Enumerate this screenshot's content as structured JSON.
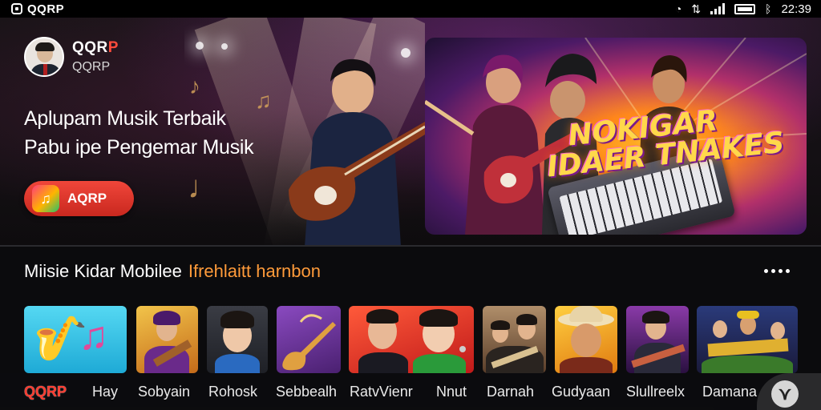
{
  "status_bar": {
    "app_name": "QQRP",
    "time": "22:39",
    "icons": [
      "app-icon",
      "wifi-icon",
      "data-icon",
      "signal-icon",
      "battery-icon",
      "bluetooth-icon"
    ]
  },
  "profile": {
    "name_prefix": "QQR",
    "name_accent": "P",
    "handle": "QQRP"
  },
  "hero": {
    "tagline_line1": "Aplupam Musik Terbaik",
    "tagline_line2": "Pabu ipe Pengemar Musik",
    "cta_label": "AQRP",
    "cta_icon": "app-logo-icon"
  },
  "promo": {
    "title_line1": "NOKIGAR",
    "title_line2": "IDAER TNAKES"
  },
  "section": {
    "title": "Miisie Kidar Mobilee",
    "accent": "Ifrehlaitt harnbon",
    "more_icon": "more-dots-icon"
  },
  "thumbnails": [
    {
      "name": "saxophone-note",
      "bg": "#36c6e8",
      "icon": "music-instrument-icon"
    },
    {
      "name": "boy-guitarist",
      "bg": "#e0a63a"
    },
    {
      "name": "boy-portrait",
      "bg": "#2d2f36"
    },
    {
      "name": "purple-guitar",
      "bg": "#6a3a9a"
    },
    {
      "name": "duo-singers",
      "bg": "#e63a2a"
    },
    {
      "name": "band-guitarists",
      "bg": "#8a6a4a"
    },
    {
      "name": "cowboy-singer",
      "bg": "#e8a020"
    },
    {
      "name": "stage-guitarist",
      "bg": "#5a2a7a"
    },
    {
      "name": "band-poster",
      "bg": "#2a3a6a"
    }
  ],
  "bottom_nav": {
    "items": [
      {
        "label": "QQRP",
        "active": true
      },
      {
        "label": "Hay",
        "active": false
      },
      {
        "label": "Sobyain",
        "active": false
      },
      {
        "label": "Rohosk",
        "active": false
      },
      {
        "label": "Sebbealh",
        "active": false
      },
      {
        "label": "RatvVienr",
        "active": false
      },
      {
        "label": "Nnut",
        "active": false
      },
      {
        "label": "Darnah",
        "active": false
      },
      {
        "label": "Gudyaan",
        "active": false
      },
      {
        "label": "Slullreelx",
        "active": false
      },
      {
        "label": "Damana",
        "active": false
      }
    ],
    "fab_icon": "chevron-down-icon",
    "colors": {
      "active": "#ff3c30",
      "inactive": "#eaeaea"
    }
  },
  "colors": {
    "brand_red": "#e8392e",
    "section_accent": "#ff9b3a",
    "background": "#0b0b0d"
  }
}
